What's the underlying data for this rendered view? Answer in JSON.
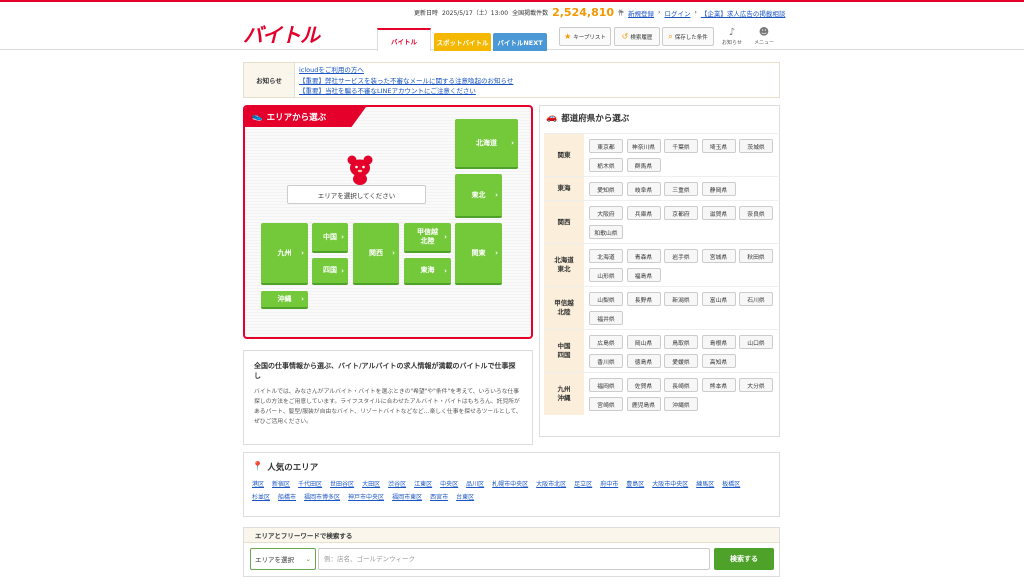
{
  "header": {
    "logo": "バイトル",
    "updated_label": "更新日時",
    "updated_at": "2025/5/17（土）13:00",
    "listings_label": "全国掲載件数",
    "listings_count": "2,524,810",
    "listings_unit": "件",
    "register_link": "新規登録",
    "login_link": "ログイン",
    "corp_link": "【企業】求人広告の掲載相談",
    "tabs": [
      "バイトル",
      "スポットバイトル",
      "バイトルNEXT"
    ],
    "tools": {
      "keeplist": "キープリスト",
      "history": "検索履歴",
      "saved": "保存した条件",
      "notice": "お知らせ",
      "menu": "メニュー"
    }
  },
  "notice": {
    "label": "お知らせ",
    "links": [
      "icloudをご利用の方へ",
      "【重要】弊社サービスを装った不審なメールに関する注意喚起のお知らせ",
      "【重要】当社を騙る不審なLINEアカウントにご注意ください"
    ]
  },
  "area": {
    "title": "エリアから選ぶ",
    "select_prompt": "エリアを選択してください",
    "regions": {
      "hokkaido": "北海道",
      "tohoku": "東北",
      "kyushu": "九州",
      "chugoku": "中国",
      "shikoku": "四国",
      "kansai": "関西",
      "koshinetsu": "甲信越\n北陸",
      "tokai": "東海",
      "kanto": "関東",
      "okinawa": "沖縄"
    }
  },
  "prefectures": {
    "title": "都道府県から選ぶ",
    "rows": [
      {
        "label": "関東",
        "items": [
          "東京都",
          "神奈川県",
          "千葉県",
          "埼玉県",
          "茨城県",
          "栃木県",
          "群馬県"
        ]
      },
      {
        "label": "東海",
        "items": [
          "愛知県",
          "岐阜県",
          "三重県",
          "静岡県"
        ]
      },
      {
        "label": "関西",
        "items": [
          "大阪府",
          "兵庫県",
          "京都府",
          "滋賀県",
          "奈良県",
          "和歌山県"
        ]
      },
      {
        "label": "北海道\n東北",
        "items": [
          "北海道",
          "青森県",
          "岩手県",
          "宮城県",
          "秋田県",
          "山形県",
          "福島県"
        ]
      },
      {
        "label": "甲信越\n北陸",
        "items": [
          "山梨県",
          "長野県",
          "新潟県",
          "富山県",
          "石川県",
          "福井県"
        ]
      },
      {
        "label": "中国\n四国",
        "items": [
          "広島県",
          "岡山県",
          "鳥取県",
          "島根県",
          "山口県",
          "香川県",
          "徳島県",
          "愛媛県",
          "高知県"
        ]
      },
      {
        "label": "九州\n沖縄",
        "items": [
          "福岡県",
          "佐賀県",
          "長崎県",
          "熊本県",
          "大分県",
          "宮崎県",
          "鹿児島県",
          "沖縄県"
        ]
      }
    ]
  },
  "description": {
    "heading": "全国の仕事情報から選ぶ、バイト/アルバイトの求人情報が満載のバイトルで仕事探し",
    "body": "バイトルでは、みなさんがアルバイト・バイトを選ぶときの\"希望\"や\"条件\"を考えて、いろいろな仕事探しの方法をご用意しています。ライフスタイルに合わせたアルバイト・バイトはもちろん、託児所があるパート、髪型/服装が自由なバイト、リゾートバイトなどなど…楽しく仕事を探せるツールとして、ぜひご活用ください。"
  },
  "popular": {
    "title": "人気のエリア",
    "links": [
      "港区",
      "新宿区",
      "千代田区",
      "世田谷区",
      "大田区",
      "渋谷区",
      "江東区",
      "中央区",
      "品川区",
      "札幌市中央区",
      "大阪市北区",
      "足立区",
      "府中市",
      "豊島区",
      "大阪市中央区",
      "練馬区",
      "板橋区",
      "杉並区",
      "船橋市",
      "福岡市博多区",
      "神戸市中央区",
      "福岡市東区",
      "西宮市",
      "台東区"
    ]
  },
  "search": {
    "heading": "エリアとフリーワードで検索する",
    "select_value": "エリアを選択",
    "placeholder": "例：店名、ゴールデンウィーク",
    "button": "検索する"
  },
  "colors": {
    "brand": "#e4002b",
    "region_green": "#74c93a",
    "count_orange": "#f39800"
  }
}
